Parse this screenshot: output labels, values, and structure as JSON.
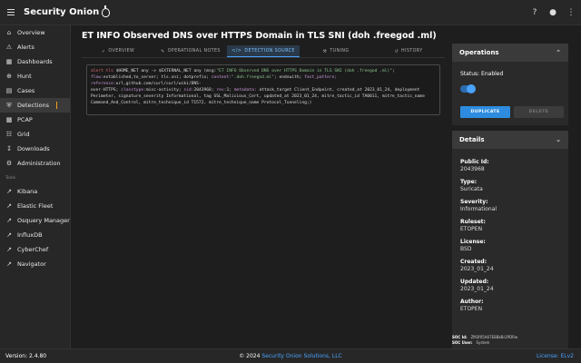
{
  "app": {
    "brand": "Security Onion"
  },
  "sidebar": {
    "items": [
      {
        "icon": "home-icon",
        "label": "Overview"
      },
      {
        "icon": "bell-icon",
        "label": "Alerts"
      },
      {
        "icon": "dashboard-icon",
        "label": "Dashboards"
      },
      {
        "icon": "crosshair-icon",
        "label": "Hunt"
      },
      {
        "icon": "folder-icon",
        "label": "Cases"
      },
      {
        "icon": "shield-icon",
        "label": "Detections"
      },
      {
        "icon": "packet-icon",
        "label": "PCAP"
      },
      {
        "icon": "grid-icon",
        "label": "Grid"
      },
      {
        "icon": "download-icon",
        "label": "Downloads"
      },
      {
        "icon": "gear-icon",
        "label": "Administration"
      }
    ],
    "tools_label": "Tools",
    "tools": [
      {
        "icon": "external-link-icon",
        "label": "Kibana"
      },
      {
        "icon": "external-link-icon",
        "label": "Elastic Fleet"
      },
      {
        "icon": "external-link-icon",
        "label": "Osquery Manager"
      },
      {
        "icon": "external-link-icon",
        "label": "InfluxDB"
      },
      {
        "icon": "external-link-icon",
        "label": "CyberChef"
      },
      {
        "icon": "external-link-icon",
        "label": "Navigator"
      }
    ]
  },
  "page": {
    "title": "ET INFO Observed DNS over HTTPS Domain in TLS SNI (doh .freegod .ml)"
  },
  "tabs": [
    {
      "icon": "overview-icon",
      "label": "Overview",
      "active": false
    },
    {
      "icon": "notes-icon",
      "label": "Operational Notes",
      "active": false
    },
    {
      "icon": "code-icon",
      "label": "Detection Source",
      "active": true
    },
    {
      "icon": "wrench-icon",
      "label": "Tuning",
      "active": false
    },
    {
      "icon": "history-icon",
      "label": "History",
      "active": false
    }
  ],
  "rule": {
    "action": "alert",
    "proto": "tls",
    "src": "$HOME_NET any -> $EXTERNAL_NET any (msg:",
    "msg": "\"ET INFO Observed DNS over HTTPS Domain in TLS SNI (doh .freegod .ml)\"",
    "line2_a": "flow:",
    "line2_b": "established,to_server; tls.sni; dotprefix; ",
    "line2_c": "content:",
    "line2_d": "\".doh.freegod.ml\"",
    "line2_e": "; endswith; ",
    "line2_f": "fast_pattern; ",
    "line2_g": "reference:",
    "line2_h": "url,github.com/curl/curl/wiki/DNS-",
    "line3_a": "over-HTTPS; ",
    "line3_b": "classtype:",
    "line3_c": "misc-activity; ",
    "line3_d": "sid:",
    "line3_e": "2043968; ",
    "line3_f": "rev:",
    "line3_g": "1; ",
    "line3_h": "metadata:",
    "line3_i": "attack_target Client_Endpoint, created_at 2023_01_24, deployment",
    "line4": "Perimeter, signature_severity Informational, tag SSL_Malicious_Cert, updated_at 2023_01_24, mitre_tactic_id TA0011, mitre_tactic_name",
    "line5": "Command_And_Control, mitre_technique_id T1572, mitre_technique_name Protocol_Tunneling;)"
  },
  "operations": {
    "title": "Operations",
    "status": "Status: Enabled",
    "enabled": true,
    "duplicate": "DUPLICATE",
    "delete": "DELETE"
  },
  "details": {
    "title": "Details",
    "fields": [
      {
        "label": "Public Id:",
        "value": "2043968"
      },
      {
        "label": "Type:",
        "value": "Suricata"
      },
      {
        "label": "Severity:",
        "value": "Informational"
      },
      {
        "label": "Ruleset:",
        "value": "ETOPEN"
      },
      {
        "label": "License:",
        "value": "BSD"
      },
      {
        "label": "Created:",
        "value": "2023_01_24"
      },
      {
        "label": "Updated:",
        "value": "2023_01_24"
      },
      {
        "label": "Author:",
        "value": "ETOPEN"
      }
    ],
    "soc_id_label": "SOC Id:",
    "soc_id": "ZM3f05A67E8BkBr2PDRw",
    "soc_user_label": "SOC User:",
    "soc_user": "System"
  },
  "footer": {
    "version": "Version: 2.4.80",
    "copyright_prefix": "© 2024 ",
    "company": "Security Onion Solutions, LLC",
    "license": "License: ELv2"
  }
}
